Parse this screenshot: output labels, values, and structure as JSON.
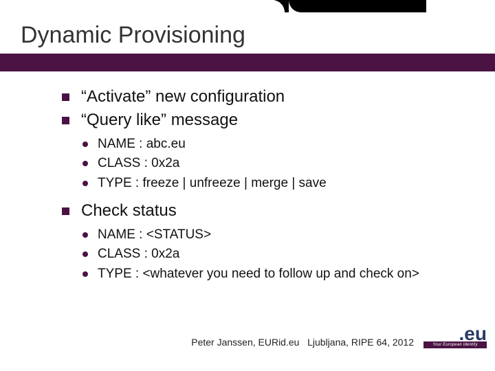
{
  "title": "Dynamic Provisioning",
  "bullets": {
    "b1": "“Activate” new configuration",
    "b2": "“Query like” message",
    "b2_sub": {
      "s1": "NAME : abc.eu",
      "s2": "CLASS : 0x2a",
      "s3": "TYPE : freeze | unfreeze | merge | save"
    },
    "b3": "Check status",
    "b3_sub": {
      "s1": "NAME : <STATUS>",
      "s2": "CLASS : 0x2a",
      "s3": "TYPE : <whatever you need to follow up and check on>"
    }
  },
  "footer": {
    "author": "Peter Janssen, EURid.eu",
    "venue": "Ljubljana, RIPE 64, 2012",
    "logo_text": ".eu",
    "logo_tag": "Your European Identity"
  }
}
